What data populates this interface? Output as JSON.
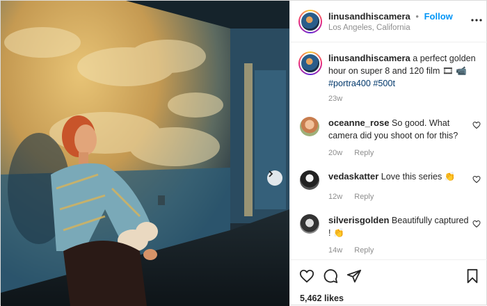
{
  "post": {
    "username": "linusandhiscamera",
    "dot": "•",
    "follow_label": "Follow",
    "location": "Los Angeles, California"
  },
  "caption": {
    "username": "linusandhiscamera",
    "text": "a perfect golden hour on super 8 and 120 film",
    "emojis": "🎞 📹",
    "hashtags": [
      "#portra400",
      "#500t"
    ],
    "time": "23w"
  },
  "comments": [
    {
      "username": "oceanne_rose",
      "text": "So good. What camera did you shoot on for this?",
      "time": "20w",
      "reply": "Reply"
    },
    {
      "username": "vedaskatter",
      "text": "Love this series 👏",
      "time": "12w",
      "reply": "Reply"
    },
    {
      "username": "silverisgolden",
      "text": "Beautifully captured ! 👏",
      "time": "14w",
      "reply": "Reply"
    }
  ],
  "likes": "5,462 likes",
  "icons": {
    "more": "more-horizontal-icon",
    "next": "chevron-right-icon",
    "like": "heart-icon",
    "comment": "comment-icon",
    "share": "send-icon",
    "save": "bookmark-icon"
  },
  "colors": {
    "accent": "#0095f6",
    "hashtag": "#00376b",
    "muted": "#8e8e8e"
  }
}
